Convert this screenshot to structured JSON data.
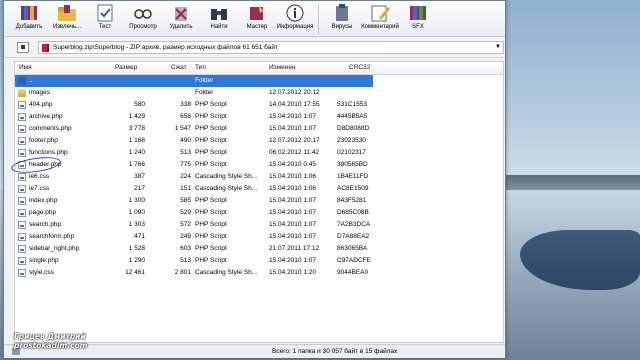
{
  "toolbar": {
    "buttons": [
      {
        "label": "Добавить"
      },
      {
        "label": "Извлечь..."
      },
      {
        "label": "Тест"
      },
      {
        "label": "Просмотр"
      },
      {
        "label": "Удалить"
      },
      {
        "label": "Найти"
      },
      {
        "label": "Мастер"
      },
      {
        "label": "Информация"
      },
      {
        "label": "Вирусы"
      },
      {
        "label": "Комментарий"
      },
      {
        "label": "SFX"
      }
    ]
  },
  "address": {
    "text": "Superblog.zip\\Superblog - ZIP архив, размер исходных файлов 61 651 байт"
  },
  "columns": {
    "name": "Имя",
    "size": "Размер",
    "packed": "Сжат",
    "type": "Тип",
    "modified": "Изменен",
    "crc": "CRC32"
  },
  "rows": [
    {
      "name": "..",
      "size": "",
      "packed": "",
      "type": "Folder",
      "modified": "",
      "crc": ""
    },
    {
      "name": "images",
      "size": "",
      "packed": "",
      "type": "Folder",
      "modified": "12.07.2012 20:12",
      "crc": ""
    },
    {
      "name": "404.php",
      "size": "580",
      "packed": "338",
      "type": "PHP Script",
      "modified": "14.04.2010 17:55",
      "crc": "531C1553"
    },
    {
      "name": "archive.php",
      "size": "1 429",
      "packed": "658",
      "type": "PHP Script",
      "modified": "15.04.2010 1:07",
      "crc": "4445B5A5"
    },
    {
      "name": "comments.php",
      "size": "3 778",
      "packed": "1 547",
      "type": "PHP Script",
      "modified": "15.04.2010 1:07",
      "crc": "D8D8088D"
    },
    {
      "name": "footer.php",
      "size": "1 168",
      "packed": "490",
      "type": "PHP Script",
      "modified": "12.07.2012 20:17",
      "crc": "23023530"
    },
    {
      "name": "functions.php",
      "size": "1 240",
      "packed": "513",
      "type": "PHP Script",
      "modified": "06.02.2012 11:42",
      "crc": "02102317"
    },
    {
      "name": "header.php",
      "size": "1 766",
      "packed": "775",
      "type": "PHP Script",
      "modified": "15.04.2010 0:45",
      "crc": "390565BD"
    },
    {
      "name": "ie6.css",
      "size": "387",
      "packed": "224",
      "type": "Cascading Style Sh...",
      "modified": "15.04.2010 1:06",
      "crc": "1B4E11FD"
    },
    {
      "name": "ie7.css",
      "size": "217",
      "packed": "151",
      "type": "Cascading Style Sh...",
      "modified": "15.04.2010 1:06",
      "crc": "AC8E1509"
    },
    {
      "name": "index.php",
      "size": "1 300",
      "packed": "585",
      "type": "PHP Script",
      "modified": "15.04.2010 1:07",
      "crc": "843F5281"
    },
    {
      "name": "page.php",
      "size": "1 090",
      "packed": "529",
      "type": "PHP Script",
      "modified": "15.04.2010 1:07",
      "crc": "D685C08B"
    },
    {
      "name": "search.php",
      "size": "1 303",
      "packed": "572",
      "type": "PHP Script",
      "modified": "15.04.2010 1:07",
      "crc": "7A2B3DCA"
    },
    {
      "name": "searchform.php",
      "size": "471",
      "packed": "249",
      "type": "PHP Script",
      "modified": "15.04.2010 1:07",
      "crc": "D7A88EA2"
    },
    {
      "name": "sidebar_right.php",
      "size": "1 528",
      "packed": "603",
      "type": "PHP Script",
      "modified": "21.07.2011 17:12",
      "crc": "863065BA"
    },
    {
      "name": "single.php",
      "size": "1 290",
      "packed": "513",
      "type": "PHP Script",
      "modified": "15.04.2010 1:07",
      "crc": "C97ADCFE"
    },
    {
      "name": "style.css",
      "size": "12 461",
      "packed": "2 801",
      "type": "Cascading Style Sh...",
      "modified": "15.04.2010 1:20",
      "crc": "9044BEA0"
    }
  ],
  "status": {
    "text": "Всего: 1 папка и 30 057 байт в 15 файлах"
  },
  "watermark": {
    "line1": "Грицев Дмитрий",
    "line2": "prostokadim.com"
  }
}
